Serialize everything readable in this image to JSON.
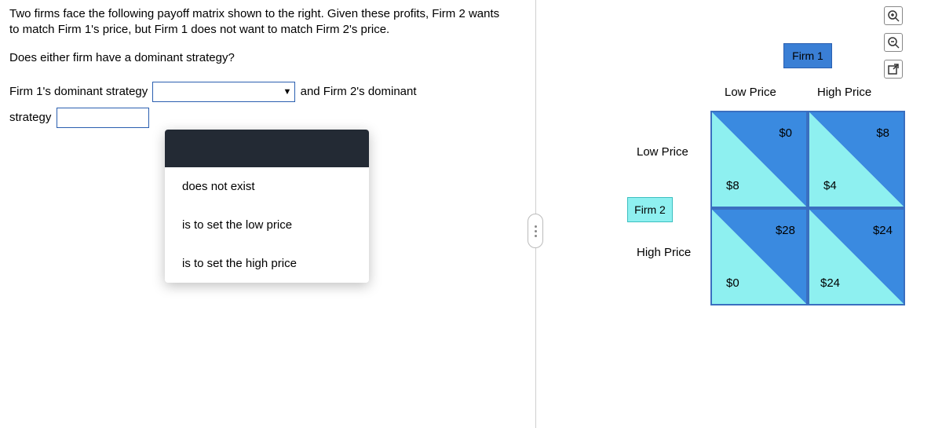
{
  "question": {
    "intro": "Two firms face the following payoff matrix shown to the right.  Given these profits, Firm 2 wants to match Firm 1's price, but Firm 1 does not want to match Firm 2's price.",
    "prompt": "Does either firm have a dominant strategy?",
    "line_part1": "Firm 1's dominant strategy",
    "line_part2": "and Firm 2's dominant",
    "line_part3": "strategy"
  },
  "dropdown": {
    "options": [
      "",
      "does not exist",
      "is to set the low price",
      "is to set the high price"
    ],
    "selected_index": 0
  },
  "matrix": {
    "firm1_label": "Firm 1",
    "firm2_label": "Firm 2",
    "col_headers": [
      "Low Price",
      "High Price"
    ],
    "row_headers": [
      "Low Price",
      "High Price"
    ],
    "cells": [
      {
        "firm1": "$0",
        "firm2": "$8"
      },
      {
        "firm1": "$8",
        "firm2": "$4"
      },
      {
        "firm1": "$28",
        "firm2": "$0"
      },
      {
        "firm1": "$24",
        "firm2": "$24"
      }
    ]
  },
  "icons": {
    "zoom_in": "zoom-in",
    "zoom_out": "zoom-out",
    "popout": "popout"
  }
}
